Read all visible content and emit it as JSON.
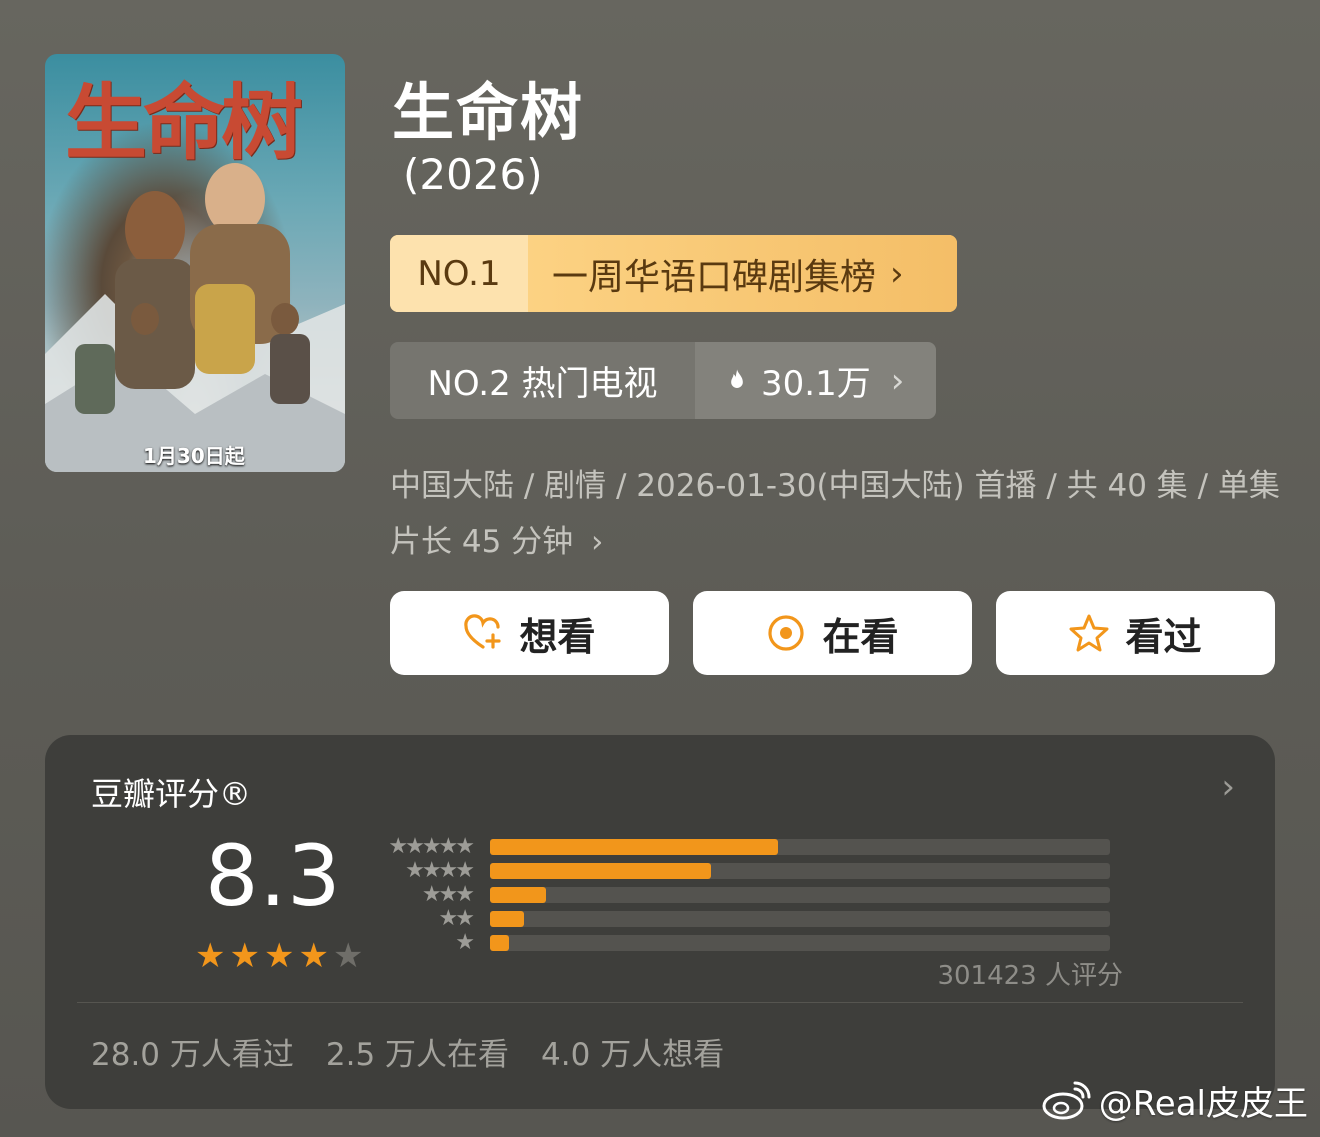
{
  "poster": {
    "title_text": "生命树",
    "release_note": "1月30日起"
  },
  "header": {
    "title": "生命树",
    "year": "(2026)"
  },
  "rank_primary": {
    "rank": "NO.1",
    "label": "一周华语口碑剧集榜",
    "chevron": "›"
  },
  "rank_secondary": {
    "rank_label": "NO.2 热门电视",
    "heat": "30.1万",
    "chevron": "›",
    "icon": "flame-icon"
  },
  "meta": {
    "text": "中国大陆 / 剧情 / 2026-01-30(中国大陆) 首播 / 共 40 集 / 单集片长 45 分钟",
    "chevron": "›"
  },
  "actions": [
    {
      "label": "想看",
      "icon": "heart-plus-icon"
    },
    {
      "label": "在看",
      "icon": "target-icon"
    },
    {
      "label": "看过",
      "icon": "star-outline-icon"
    }
  ],
  "rating": {
    "title": "豆瓣评分®",
    "chevron": "›",
    "score": "8.3",
    "stars_filled": 4,
    "stars_total": 5,
    "distribution": [
      {
        "stars": "★★★★★",
        "fraction": 0.465
      },
      {
        "stars": "★★★★",
        "fraction": 0.357
      },
      {
        "stars": "★★★",
        "fraction": 0.09
      },
      {
        "stars": "★★",
        "fraction": 0.055
      },
      {
        "stars": "★",
        "fraction": 0.03
      }
    ],
    "count": "301423 人评分",
    "stats": [
      "28.0 万人看过",
      "2.5 万人在看",
      "4.0 万人想看"
    ]
  },
  "colors": {
    "accent": "#f2961b",
    "gold_badge": "#f7c46a",
    "card_bg": "#3e3e3b"
  },
  "watermark": {
    "text": "@Real皮皮王",
    "icon": "weibo-icon"
  }
}
